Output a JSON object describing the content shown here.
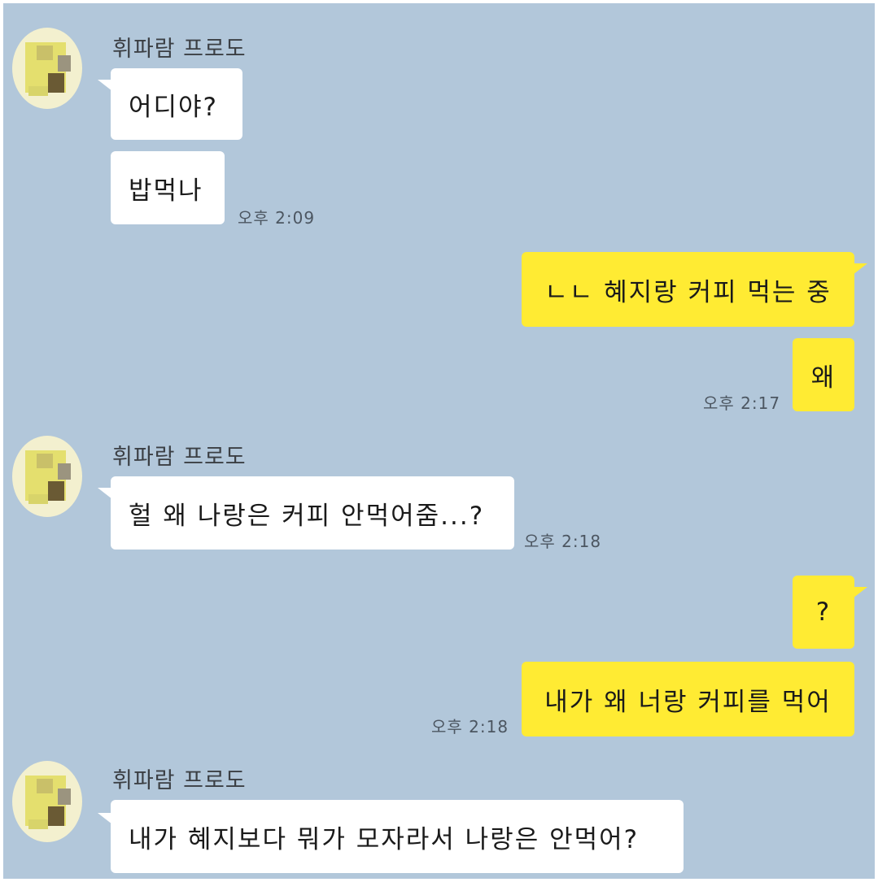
{
  "messages": [
    {
      "sender": "휘파람 프로도",
      "texts": [
        "어디야?",
        "밥먹나"
      ],
      "time": "오후 2:09"
    },
    {
      "texts": [
        "ㄴㄴ 혜지랑 커피 먹는 중",
        "왜"
      ],
      "time": "오후 2:17"
    },
    {
      "sender": "휘파람 프로도",
      "texts": [
        "헐 왜 나랑은 커피 안먹어줌...?"
      ],
      "time": "오후 2:18"
    },
    {
      "texts": [
        "?",
        "내가 왜 너랑 커피를 먹어"
      ],
      "time": "오후 2:18"
    },
    {
      "sender": "휘파람 프로도",
      "texts": [
        "내가 혜지보다 뭐가 모자라서 나랑은 안먹어?"
      ]
    }
  ],
  "colors": {
    "background": "#b2c7da",
    "incoming_bubble": "#ffffff",
    "outgoing_bubble": "#ffeb33"
  },
  "icons": {
    "avatar": "pixelated-profile-avatar"
  }
}
